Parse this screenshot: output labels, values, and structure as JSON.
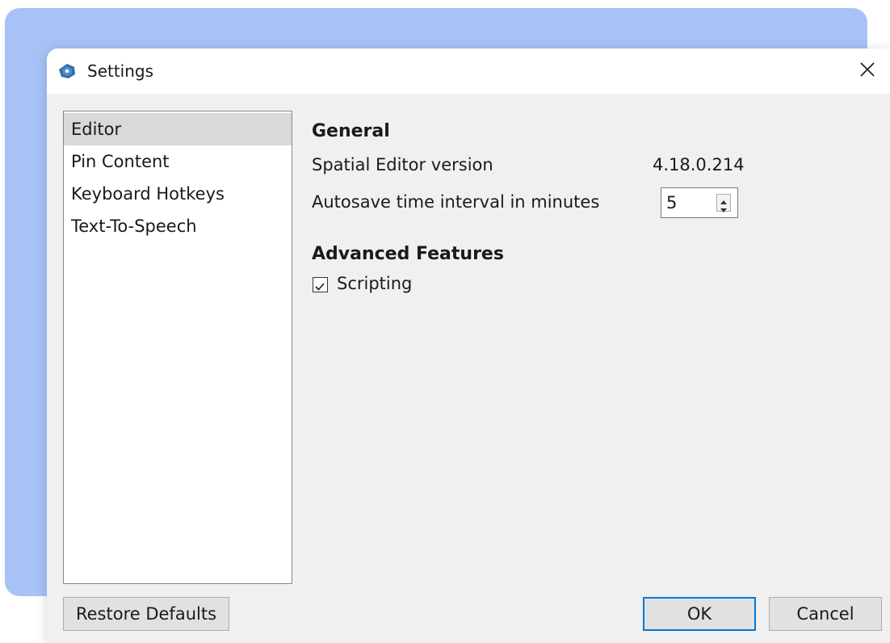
{
  "window": {
    "title": "Settings",
    "app_icon": "app-logo-icon",
    "close_icon": "close-icon"
  },
  "sidebar": {
    "items": [
      {
        "label": "Editor",
        "selected": true
      },
      {
        "label": "Pin Content",
        "selected": false
      },
      {
        "label": "Keyboard Hotkeys",
        "selected": false
      },
      {
        "label": "Text-To-Speech",
        "selected": false
      }
    ]
  },
  "general": {
    "heading": "General",
    "version_label": "Spatial Editor version",
    "version_value": "4.18.0.214",
    "autosave_label": "Autosave time interval in minutes",
    "autosave_value": "5"
  },
  "advanced": {
    "heading": "Advanced Features",
    "scripting_label": "Scripting",
    "scripting_checked": true
  },
  "footer": {
    "restore_label": "Restore Defaults",
    "ok_label": "OK",
    "cancel_label": "Cancel"
  },
  "colors": {
    "backdrop": "#a8c2f7",
    "dialog_bg": "#f0f0f0",
    "selection": "#d9d9d9",
    "default_button_border": "#0078d7"
  }
}
